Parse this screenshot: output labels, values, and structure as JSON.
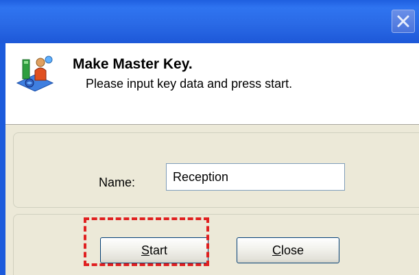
{
  "header": {
    "title": "Make Master Key.",
    "subtitle": "Please input key data and press start."
  },
  "form": {
    "name_label": "Name:",
    "name_value": "Reception"
  },
  "buttons": {
    "start": {
      "mnemonic": "S",
      "rest": "tart"
    },
    "close": {
      "mnemonic": "C",
      "rest": "lose"
    }
  },
  "colors": {
    "titlebar": "#2a6ae6",
    "dialog_bg": "#ece9d8",
    "highlight": "#e02020"
  },
  "icons": {
    "title_close": "close-icon",
    "header": "network-users-icon"
  }
}
